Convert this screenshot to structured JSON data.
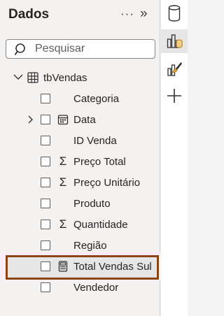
{
  "pane": {
    "title": "Dados",
    "more_icon": "ellipsis-icon",
    "collapse_icon": "double-chevron-right-icon"
  },
  "search": {
    "placeholder": "Pesquisar",
    "value": ""
  },
  "table": {
    "name": "tbVendas",
    "expanded": true,
    "fields": [
      {
        "label": "Categoria",
        "icon": "",
        "expandable": false,
        "checked": false
      },
      {
        "label": "Data",
        "icon": "calendar-icon",
        "expandable": true,
        "checked": false
      },
      {
        "label": "ID Venda",
        "icon": "",
        "expandable": false,
        "checked": false
      },
      {
        "label": "Preço Total",
        "icon": "sigma-icon",
        "expandable": false,
        "checked": false
      },
      {
        "label": "Preço Unitário",
        "icon": "sigma-icon",
        "expandable": false,
        "checked": false
      },
      {
        "label": "Produto",
        "icon": "",
        "expandable": false,
        "checked": false
      },
      {
        "label": "Quantidade",
        "icon": "sigma-icon",
        "expandable": false,
        "checked": false
      },
      {
        "label": "Região",
        "icon": "",
        "expandable": false,
        "checked": false
      },
      {
        "label": "Total Vendas Sul",
        "icon": "calculator-icon",
        "expandable": false,
        "checked": false,
        "highlighted": true
      },
      {
        "label": "Vendedor",
        "icon": "",
        "expandable": false,
        "checked": false
      }
    ]
  },
  "rail": {
    "buttons": [
      {
        "icon": "database-icon",
        "active": false
      },
      {
        "icon": "build-visual-icon",
        "active": true
      },
      {
        "icon": "format-brush-icon",
        "active": false
      },
      {
        "icon": "plus-icon",
        "active": false
      }
    ]
  },
  "colors": {
    "highlight_border": "#8b4513",
    "highlight_glow": "#fdeefc",
    "accent_orange": "#e8a33d"
  }
}
